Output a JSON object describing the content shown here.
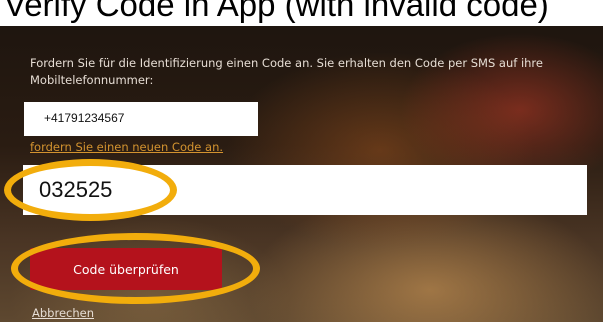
{
  "top_bar": {
    "text": "Verify Code in App (with invalid code)"
  },
  "form": {
    "instructions": "Fordern Sie für die Identifizierung einen Code an. Sie erhalten den Code per SMS auf ihre Mobiltelefonnummer:",
    "phone_number": "+41791234567",
    "resend_link": "fordern Sie einen neuen Code an.",
    "code_value": "032525",
    "verify_button": "Code überprüfen",
    "cancel_link": "Abbrechen"
  },
  "annotations": {
    "highlight_color": "#f2ad0c",
    "highlighted": [
      "code-input",
      "verify-code-button"
    ]
  },
  "colors": {
    "primary_button": "#b4121c",
    "link": "#d3932f"
  }
}
